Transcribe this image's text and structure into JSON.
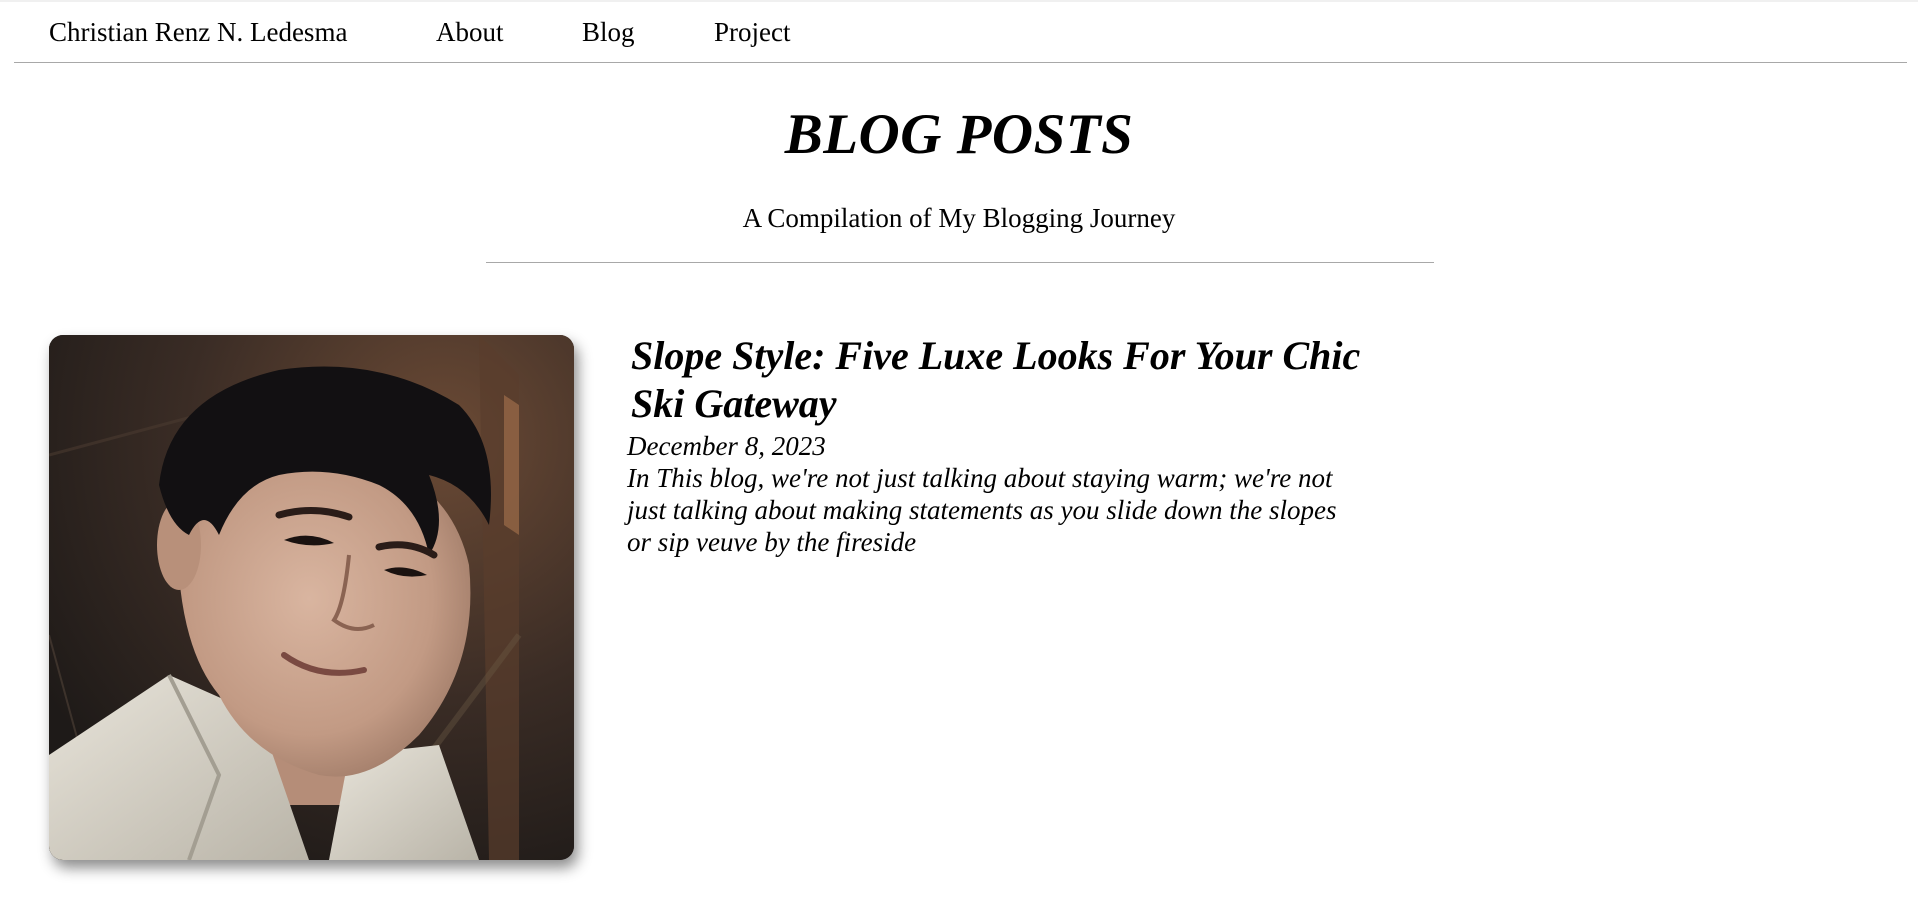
{
  "nav": {
    "brand": "Christian Renz N. Ledesma",
    "links": [
      {
        "label": "About"
      },
      {
        "label": "Blog"
      },
      {
        "label": "Project"
      }
    ]
  },
  "hero": {
    "title": "BLOG POSTS",
    "subtitle": "A Compilation of My Blogging Journey"
  },
  "posts": [
    {
      "title": "Slope Style: Five Luxe Looks For Your Chic Ski Gateway",
      "date": "December 8, 2023",
      "excerpt": "In This blog, we're not just talking about staying warm; we're not just talking about making statements as you slide down the slopes or sip veuve by the fireside",
      "image": "author-selfie-photo"
    }
  ],
  "colors": {
    "divider": "#a8a8a8",
    "text": "#000000",
    "background": "#ffffff"
  }
}
